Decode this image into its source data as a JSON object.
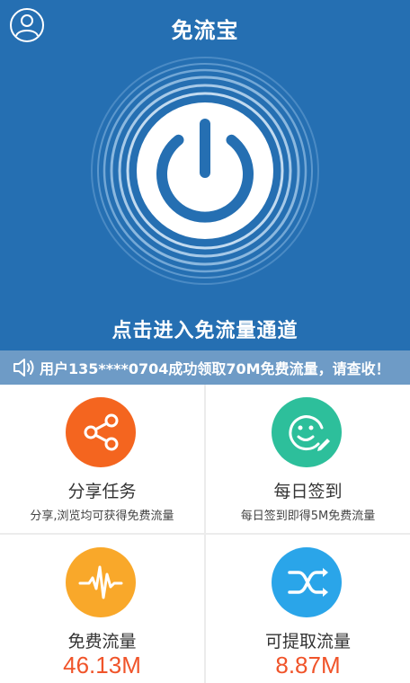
{
  "header": {
    "title": "免流宝",
    "avatar_icon": "user-avatar-icon"
  },
  "hero": {
    "power_icon": "power-icon",
    "enter_label": "点击进入免流量通道",
    "background_color": "#256fb2"
  },
  "notice": {
    "icon": "speaker-icon",
    "text": "用户135****0704成功领取70M免费流量，请查收！"
  },
  "tiles": [
    {
      "title": "分享任务",
      "subtitle": "分享,浏览均可获得免费流量",
      "icon": "share-icon",
      "color": "#f4651f"
    },
    {
      "title": "每日签到",
      "subtitle": "每日签到即得5M免费流量",
      "icon": "smiley-sign-in-icon",
      "color": "#2dbf9b"
    },
    {
      "title": "免费流量",
      "value": "46.13M",
      "icon": "pulse-icon",
      "color": "#f9a82a"
    },
    {
      "title": "可提取流量",
      "value": "8.87M",
      "icon": "shuffle-icon",
      "color": "#2aa5e9"
    }
  ],
  "accent_value_color": "#f0542a"
}
